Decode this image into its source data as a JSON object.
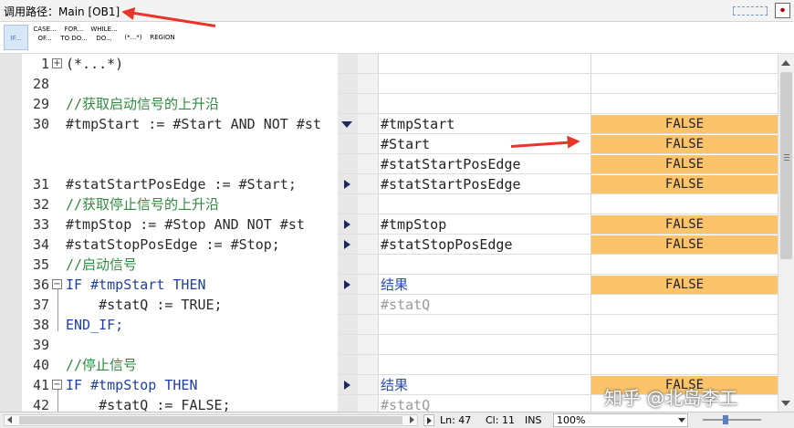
{
  "header": {
    "call_path": "调用路径：Main [OB1]"
  },
  "toolbar": {
    "buttons": [
      "IF...",
      "CASE...\nOF...",
      "FOR...\nTO DO...",
      "WHILE...\nDO...",
      "(*...*)",
      "REGION"
    ]
  },
  "editor": {
    "lines": [
      {
        "num": "1",
        "text": "(*...*)",
        "fold": "plus"
      },
      {
        "num": "28",
        "text": ""
      },
      {
        "num": "29",
        "text": "//获取启动信号的上升沿"
      },
      {
        "num": "30",
        "text": "#tmpStart := #Start AND NOT #st"
      },
      {
        "num": "",
        "text": ""
      },
      {
        "num": "",
        "text": ""
      },
      {
        "num": "31",
        "text": "#statStartPosEdge := #Start;"
      },
      {
        "num": "32",
        "text": "//获取停止信号的上升沿"
      },
      {
        "num": "33",
        "text": "#tmpStop := #Stop AND NOT #st"
      },
      {
        "num": "34",
        "text": "#statStopPosEdge := #Stop;"
      },
      {
        "num": "35",
        "text": "//启动信号"
      },
      {
        "num": "36",
        "text": "IF #tmpStart THEN",
        "fold": "minus"
      },
      {
        "num": "37",
        "text": "    #statQ := TRUE;"
      },
      {
        "num": "38",
        "text": "END_IF;"
      },
      {
        "num": "39",
        "text": ""
      },
      {
        "num": "40",
        "text": "//停止信号"
      },
      {
        "num": "41",
        "text": "IF #tmpStop THEN",
        "fold": "minus"
      },
      {
        "num": "42",
        "text": "    #statQ := FALSE;"
      }
    ]
  },
  "monitor": {
    "rows": [
      {
        "marker": "",
        "var": "",
        "value": ""
      },
      {
        "marker": "",
        "var": "",
        "value": ""
      },
      {
        "marker": "",
        "var": "",
        "value": ""
      },
      {
        "marker": "down",
        "var": "#tmpStart",
        "value": "FALSE"
      },
      {
        "marker": "",
        "var": "#Start",
        "value": "FALSE"
      },
      {
        "marker": "",
        "var": "#statStartPosEdge",
        "value": "FALSE"
      },
      {
        "marker": "right",
        "var": "#statStartPosEdge",
        "value": "FALSE"
      },
      {
        "marker": "",
        "var": "",
        "value": ""
      },
      {
        "marker": "right",
        "var": "#tmpStop",
        "value": "FALSE"
      },
      {
        "marker": "right",
        "var": "#statStopPosEdge",
        "value": "FALSE"
      },
      {
        "marker": "",
        "var": "",
        "value": ""
      },
      {
        "marker": "right",
        "var": "结果",
        "value": "FALSE",
        "style": "blue"
      },
      {
        "marker": "",
        "var": "#statQ",
        "value": "",
        "style": "gray"
      },
      {
        "marker": "",
        "var": "",
        "value": ""
      },
      {
        "marker": "",
        "var": "",
        "value": ""
      },
      {
        "marker": "",
        "var": "",
        "value": ""
      },
      {
        "marker": "right",
        "var": "结果",
        "value": "FALSE",
        "style": "blue"
      },
      {
        "marker": "",
        "var": "#statQ",
        "value": "",
        "style": "gray"
      }
    ]
  },
  "status": {
    "ln": "Ln: 47",
    "cl": "Cl: 11",
    "mode": "INS",
    "zoom": "100%"
  },
  "watermark": "知乎 @北岛李工",
  "colors": {
    "value_bg": "#fbc46a",
    "keyword": "#1f3fa8",
    "comment": "#2e8b3d",
    "annotation_arrow": "#e8342a"
  }
}
